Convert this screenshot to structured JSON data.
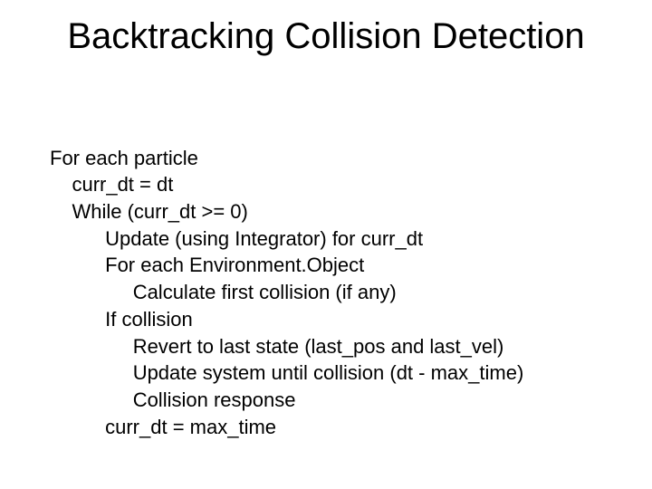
{
  "slide": {
    "title": "Backtracking Collision Detection",
    "lines": {
      "l0": "For each particle",
      "l1": "curr_dt = dt",
      "l2": "While (curr_dt >= 0)",
      "l3": "Update (using Integrator) for curr_dt",
      "l4": "For each Environment.Object",
      "l5": "Calculate first collision (if any)",
      "l6": "If collision",
      "l7": "Revert to last state (last_pos and last_vel)",
      "l8": "Update system until collision (dt - max_time)",
      "l9": "Collision response",
      "l10": "curr_dt = max_time"
    }
  }
}
